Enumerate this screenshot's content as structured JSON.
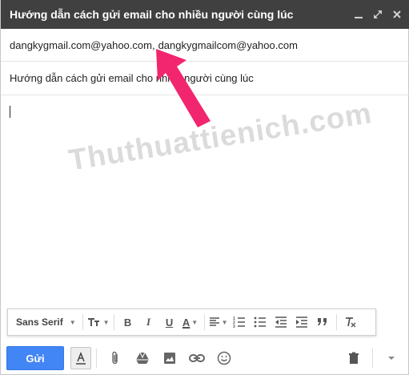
{
  "window": {
    "title": "Hướng dẫn cách gửi email cho nhiều người cùng lúc",
    "controls": [
      "minimize-icon",
      "popout-icon",
      "close-icon"
    ]
  },
  "recipients": {
    "items": [
      "dangkygmail.com@yahoo.com",
      "dangkygmailcom@yahoo.com"
    ],
    "separator": ","
  },
  "subject": {
    "value": "Hướng dẫn cách gửi email cho nhiều người cùng lúc"
  },
  "body": {
    "value": ""
  },
  "watermark": {
    "text": "Thuthuattienich.com"
  },
  "format_bar": {
    "font_family": "Sans Serif",
    "bold": "B",
    "italic": "I",
    "underline": "U",
    "text_color": "A",
    "icons": [
      "text-size-icon",
      "bold-icon",
      "italic-icon",
      "underline-icon",
      "text-color-icon",
      "align-icon",
      "numbered-list-icon",
      "bulleted-list-icon",
      "indent-less-icon",
      "indent-more-icon",
      "quote-icon",
      "remove-formatting-icon"
    ]
  },
  "bottom_bar": {
    "send_label": "Gửi",
    "icons": [
      "formatting-toggle-icon",
      "attach-icon",
      "drive-icon",
      "insert-photo-icon",
      "link-icon",
      "emoji-icon",
      "trash-icon",
      "more-options-icon"
    ]
  },
  "colors": {
    "titlebar": "#404040",
    "send_button": "#4285f4",
    "arrow": "#f2266e"
  }
}
